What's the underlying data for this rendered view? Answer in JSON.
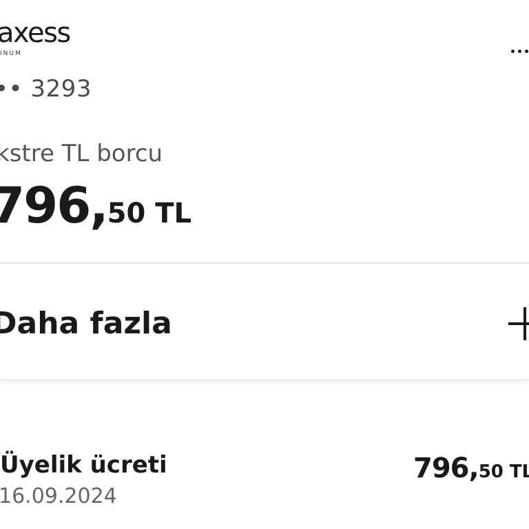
{
  "card": {
    "brand": "axess",
    "brand_sub": "INUM",
    "number": "•• 3293",
    "debt_label": "kstre TL borcu",
    "debt_whole": "796,",
    "debt_rest": "50 TL"
  },
  "more": {
    "label": "Daha fazla"
  },
  "transaction": {
    "title": "Üyelik ücreti",
    "date": "16.09.2024",
    "amount_whole": "796,",
    "amount_rest": "50 TL"
  }
}
